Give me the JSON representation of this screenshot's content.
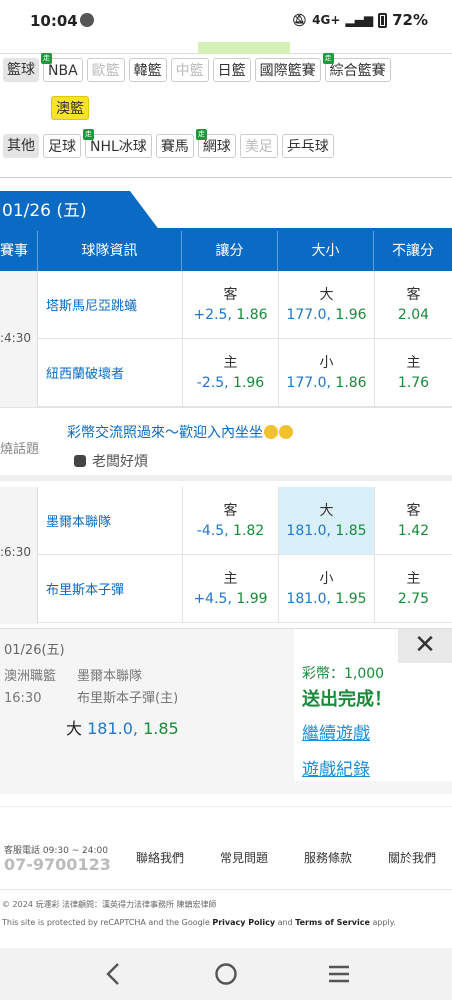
{
  "status": {
    "time": "10:04",
    "network": "4G+",
    "battery": "72%"
  },
  "categories": {
    "basketball": {
      "label": "籃球",
      "items": [
        {
          "label": "NBA",
          "badge": "走",
          "state": "normal"
        },
        {
          "label": "歐籃",
          "badge": "",
          "state": "dim"
        },
        {
          "label": "韓籃",
          "badge": "",
          "state": "normal"
        },
        {
          "label": "中籃",
          "badge": "",
          "state": "dim"
        },
        {
          "label": "日籃",
          "badge": "",
          "state": "normal"
        },
        {
          "label": "國際籃賽",
          "badge": "",
          "state": "normal"
        },
        {
          "label": "綜合籃賽",
          "badge": "走",
          "state": "normal"
        }
      ],
      "selected": "澳籃"
    },
    "other": {
      "label": "其他",
      "items": [
        {
          "label": "足球",
          "badge": "",
          "state": "normal"
        },
        {
          "label": "NHL冰球",
          "badge": "走",
          "state": "normal"
        },
        {
          "label": "賽馬",
          "badge": "",
          "state": "normal"
        },
        {
          "label": "網球",
          "badge": "走",
          "state": "normal"
        },
        {
          "label": "美足",
          "badge": "",
          "state": "dim"
        },
        {
          "label": "乒乓球",
          "badge": "",
          "state": "normal"
        }
      ]
    }
  },
  "date_tab": "01/26 (五)",
  "table_headers": {
    "event": "賽事",
    "team": "球隊資訊",
    "spread": "讓分",
    "total": "大小",
    "moneyline": "不讓分"
  },
  "games": [
    {
      "time": ":4:30",
      "rows": [
        {
          "team": "塔斯馬尼亞跳蟻",
          "spread_side": "客",
          "spread_line": "+2.5",
          "spread_odds": "1.86",
          "total_side": "大",
          "total_line": "177.0",
          "total_odds": "1.96",
          "ml_side": "客",
          "ml_odds": "2.04"
        },
        {
          "team": "紐西蘭破壞者",
          "spread_side": "主",
          "spread_line": "-2.5",
          "spread_odds": "1.96",
          "total_side": "小",
          "total_line": "177.0",
          "total_odds": "1.86",
          "ml_side": "主",
          "ml_odds": "1.76"
        }
      ]
    },
    {
      "time": ":6:30",
      "rows": [
        {
          "team": "墨爾本聯隊",
          "spread_side": "客",
          "spread_line": "-4.5",
          "spread_odds": "1.82",
          "total_side": "大",
          "total_line": "181.0",
          "total_odds": "1.85",
          "ml_side": "客",
          "ml_odds": "1.42"
        },
        {
          "team": "布里斯本子彈",
          "spread_side": "主",
          "spread_line": "+4.5",
          "spread_odds": "1.99",
          "total_side": "小",
          "total_line": "181.0",
          "total_odds": "1.95",
          "ml_side": "主",
          "ml_odds": "2.75"
        }
      ]
    }
  ],
  "talk": {
    "label": "燒話題",
    "message": "彩幣交流照過來～歡迎入內坐坐",
    "user": "老闆好煩"
  },
  "bet_popup": {
    "date": "01/26(五)",
    "league": "澳洲職籃",
    "time": "16:30",
    "team1": "墨爾本聯隊",
    "team2": "布里斯本子彈(主)",
    "pick_side": "大",
    "pick_line": "181.0",
    "pick_odds": "1.85",
    "coins": "彩幣：1,000",
    "result": "送出完成！",
    "continue": "繼續遊戲",
    "history": "遊戲紀錄",
    "close": "✕"
  },
  "footer": {
    "phone_label": "客服電話 09:30 ~ 24:00",
    "phone": "07-9700123",
    "links": [
      "聯絡我們",
      "常見問題",
      "服務條款",
      "關於我們"
    ],
    "copyright": "© 2024 玩運彩  法律顧問：漢英得力法律事務所 陳鎮宏律師",
    "recaptcha_pre": "This site is protected by reCAPTCHA and the Google ",
    "privacy": "Privacy Policy",
    "and": " and ",
    "terms": "Terms of Service",
    "apply": " apply."
  },
  "colors": {
    "brand_blue": "#0a6bc4",
    "odds_green": "#1a8a3a",
    "highlight": "#d9effa",
    "selected_chip": "#f7e32a"
  }
}
